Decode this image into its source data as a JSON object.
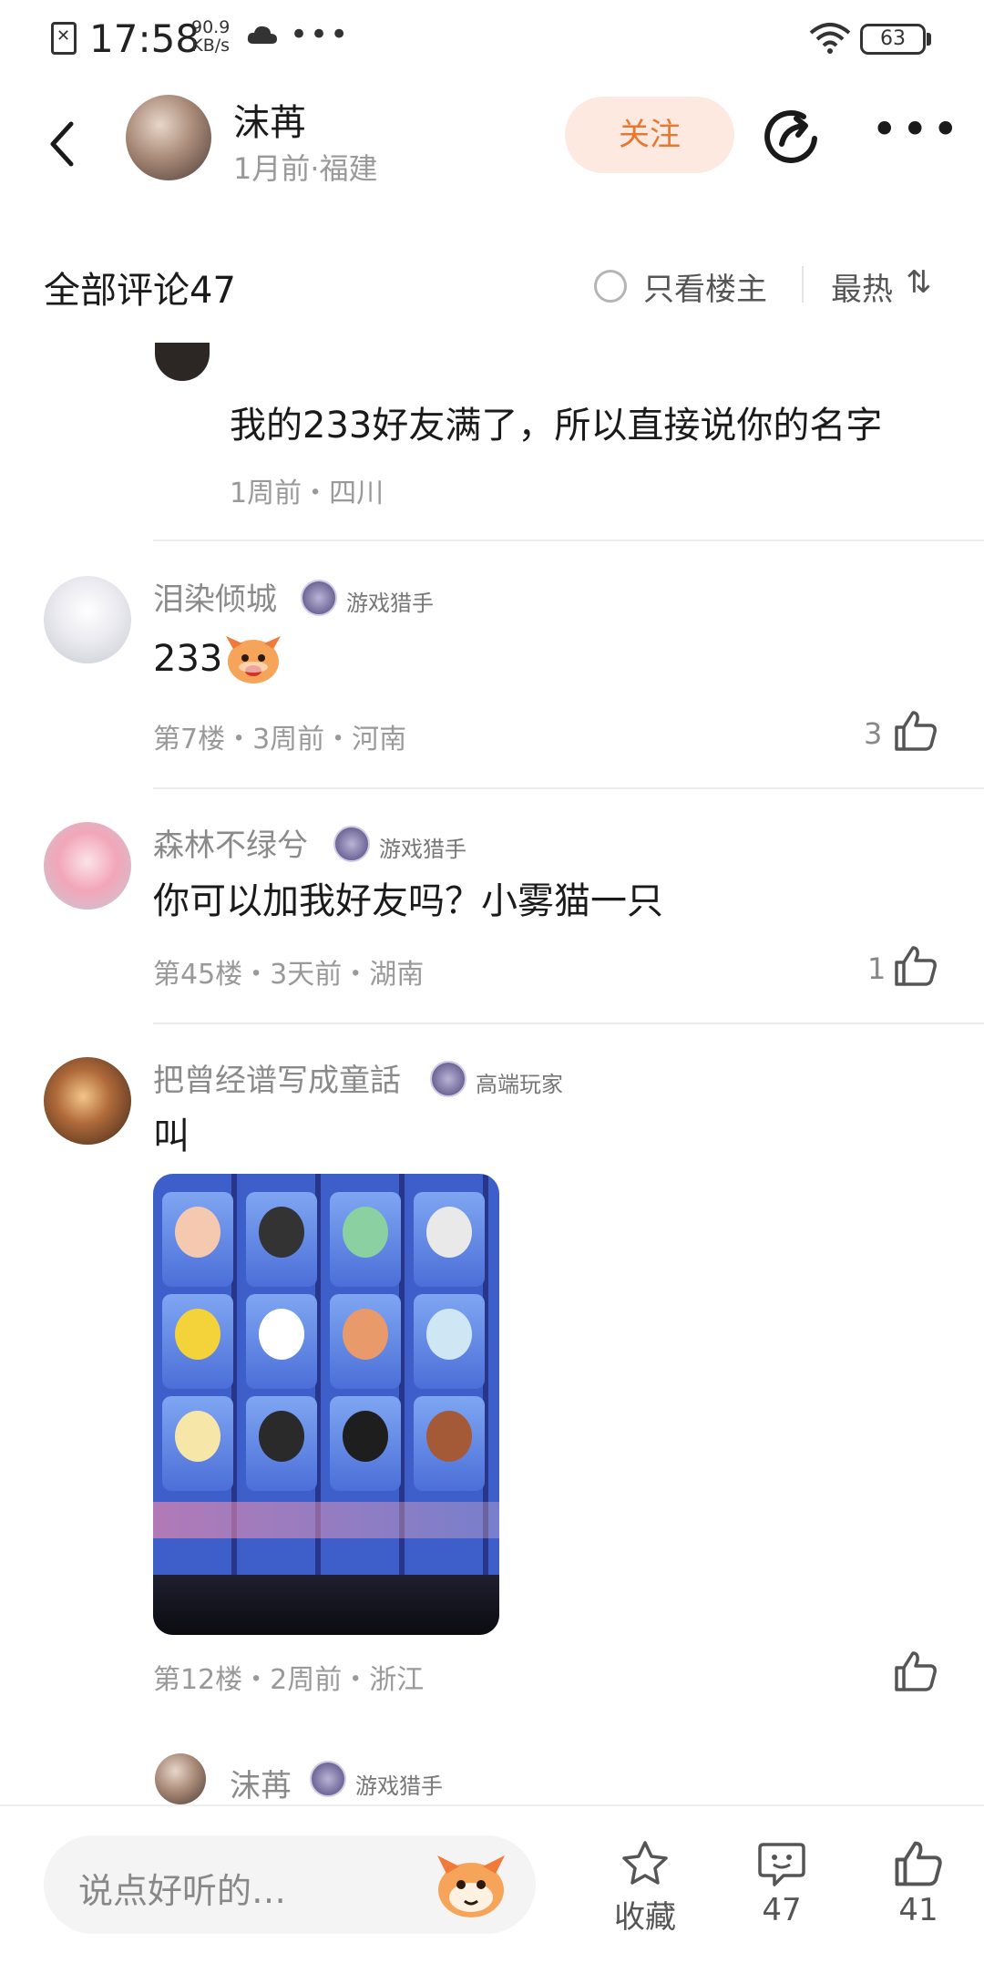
{
  "status_bar": {
    "time": "17:58",
    "net_speed_value": "90.9",
    "net_speed_unit": "KB/s",
    "battery": "63"
  },
  "header": {
    "author_name": "沫苒",
    "author_meta": "1月前·福建",
    "follow_label": "关注"
  },
  "comments_header": {
    "title": "全部评论47",
    "only_op_label": "只看楼主",
    "sort_label": "最热",
    "sort_icon": "⇅"
  },
  "reply_cutoff": {
    "text": "我的233好友满了，所以直接说你的名字",
    "meta": "1周前・四川"
  },
  "comments": [
    {
      "username": "泪染倾城",
      "badge": "游戏猎手",
      "text": "233",
      "meta": "第7楼・3周前・河南",
      "likes": "3"
    },
    {
      "username": "森林不绿兮",
      "badge": "游戏猎手",
      "text": "你可以加我好友吗？小雾猫一只",
      "meta": "第45楼・3天前・湖南",
      "likes": "1"
    },
    {
      "username": "把曾经谱写成童話",
      "badge": "高端玩家",
      "text": "叫",
      "meta": "第12楼・2周前・浙江",
      "likes": ""
    }
  ],
  "sub_reply": {
    "username": "沫苒",
    "badge": "游戏猎手"
  },
  "bottom_bar": {
    "input_placeholder": "说点好听的…",
    "favorite_label": "收藏",
    "comment_count": "47",
    "like_count": "41"
  },
  "colors": {
    "accent": "#e8772f",
    "follow_bg": "#fde9e0",
    "muted_text": "#999999"
  }
}
